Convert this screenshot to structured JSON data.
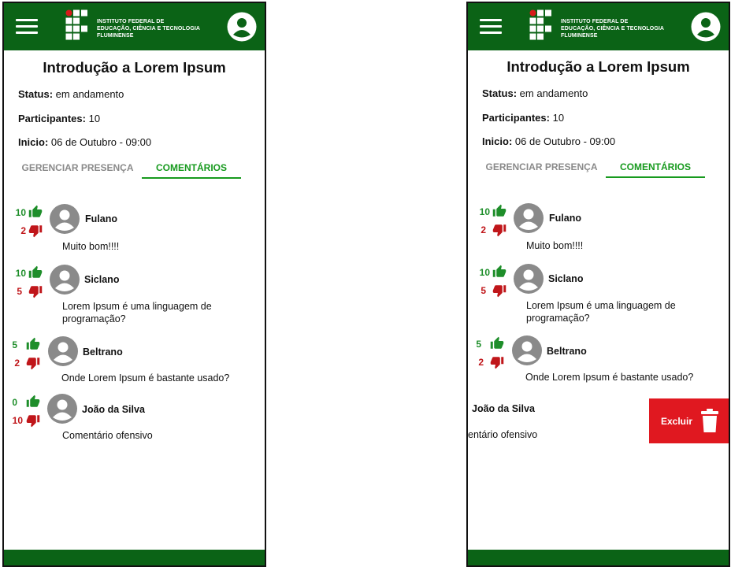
{
  "colors": {
    "header_green": "#0b6316",
    "tab_green": "#179a1e",
    "like_green": "#1e8e2a",
    "dislike_red": "#c0161a",
    "delete_red": "#e01820",
    "avatar_gray": "#8a8a8a"
  },
  "header": {
    "logo_line1": "INSTITUTO FEDERAL DE",
    "logo_line2": "EDUCAÇÃO, CIÊNCIA E TECNOLOGIA",
    "logo_line3": "FLUMINENSE",
    "menu_icon": "hamburger-icon",
    "profile_icon": "user-circle-icon"
  },
  "event": {
    "title": "Introdução a Lorem Ipsum",
    "status_label": "Status:",
    "status_value": " em andamento",
    "participants_label": "Participantes:",
    "participants_value": " 10",
    "start_label": "Inicio:",
    "start_value": " 06 de Outubro - 09:00"
  },
  "tabs": {
    "manage": "GERENCIAR PRESENÇA",
    "comments": "COMENTÁRIOS",
    "active": "comments"
  },
  "comments": [
    {
      "author": "Fulano",
      "text_lines": [
        "Muito bom!!!!"
      ],
      "likes": "10",
      "dislikes": "2"
    },
    {
      "author": "Siclano",
      "text_lines": [
        "Lorem Ipsum é uma linguagem de",
        "programação?"
      ],
      "likes": "10",
      "dislikes": "5"
    },
    {
      "author": "Beltrano",
      "text_lines": [
        "Onde Lorem Ipsum é bastante usado?"
      ],
      "likes": "5",
      "dislikes": "2"
    },
    {
      "author": "João da Silva",
      "text_lines": [
        "Comentário ofensivo"
      ],
      "likes": "0",
      "dislikes": "10"
    }
  ],
  "swiped": {
    "author": "João da Silva",
    "text": "entário ofensivo",
    "delete_label": "Excluir",
    "delete_icon": "trash-icon"
  }
}
